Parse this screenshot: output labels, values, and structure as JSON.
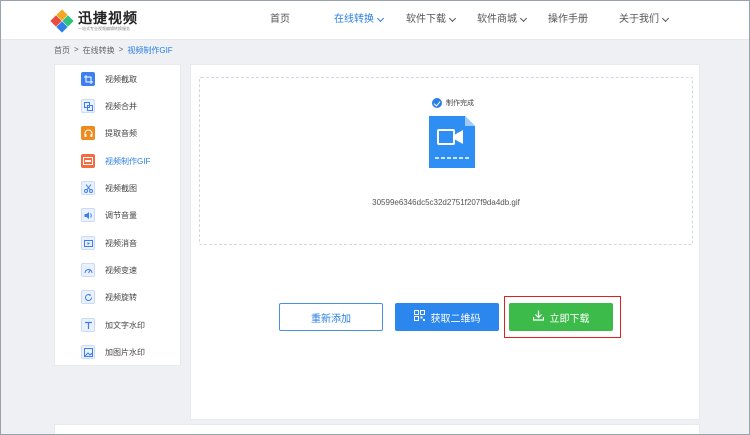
{
  "brand": {
    "name": "迅捷视频",
    "tagline": "一站式专业视频编辑转换服务"
  },
  "nav": {
    "items": [
      {
        "label": "首页",
        "caret": false
      },
      {
        "label": "在线转换",
        "caret": true,
        "active": true
      },
      {
        "label": "软件下载",
        "caret": true
      },
      {
        "label": "软件商城",
        "caret": true
      },
      {
        "label": "操作手册",
        "caret": false
      },
      {
        "label": "关于我们",
        "caret": true
      }
    ]
  },
  "breadcrumb": {
    "home": "首页",
    "sep1": ">",
    "section": "在线转换",
    "sep2": ">",
    "current": "视频制作GIF"
  },
  "sidebar": {
    "items": [
      {
        "label": "视频截取",
        "icon": "crop-icon"
      },
      {
        "label": "视频合并",
        "icon": "merge-icon"
      },
      {
        "label": "提取音频",
        "icon": "headphones-icon"
      },
      {
        "label": "视频制作GIF",
        "icon": "gif-icon",
        "active": true
      },
      {
        "label": "视频截图",
        "icon": "scissors-icon"
      },
      {
        "label": "调节音量",
        "icon": "volume-icon"
      },
      {
        "label": "视频消音",
        "icon": "mute-icon"
      },
      {
        "label": "视频变速",
        "icon": "speed-icon"
      },
      {
        "label": "视频旋转",
        "icon": "rotate-icon"
      },
      {
        "label": "加文字水印",
        "icon": "text-watermark-icon"
      },
      {
        "label": "加图片水印",
        "icon": "image-watermark-icon"
      }
    ]
  },
  "result": {
    "status": "制作完成",
    "filename": "30599e6346dc5c32d2751f207f9da4db.gif"
  },
  "actions": {
    "readd_label": "重新添加",
    "qr_label": "获取二维码",
    "download_label": "立即下载"
  },
  "colors": {
    "accent": "#2a7fe8",
    "download": "#3cba4a",
    "highlight": "#e02020"
  }
}
